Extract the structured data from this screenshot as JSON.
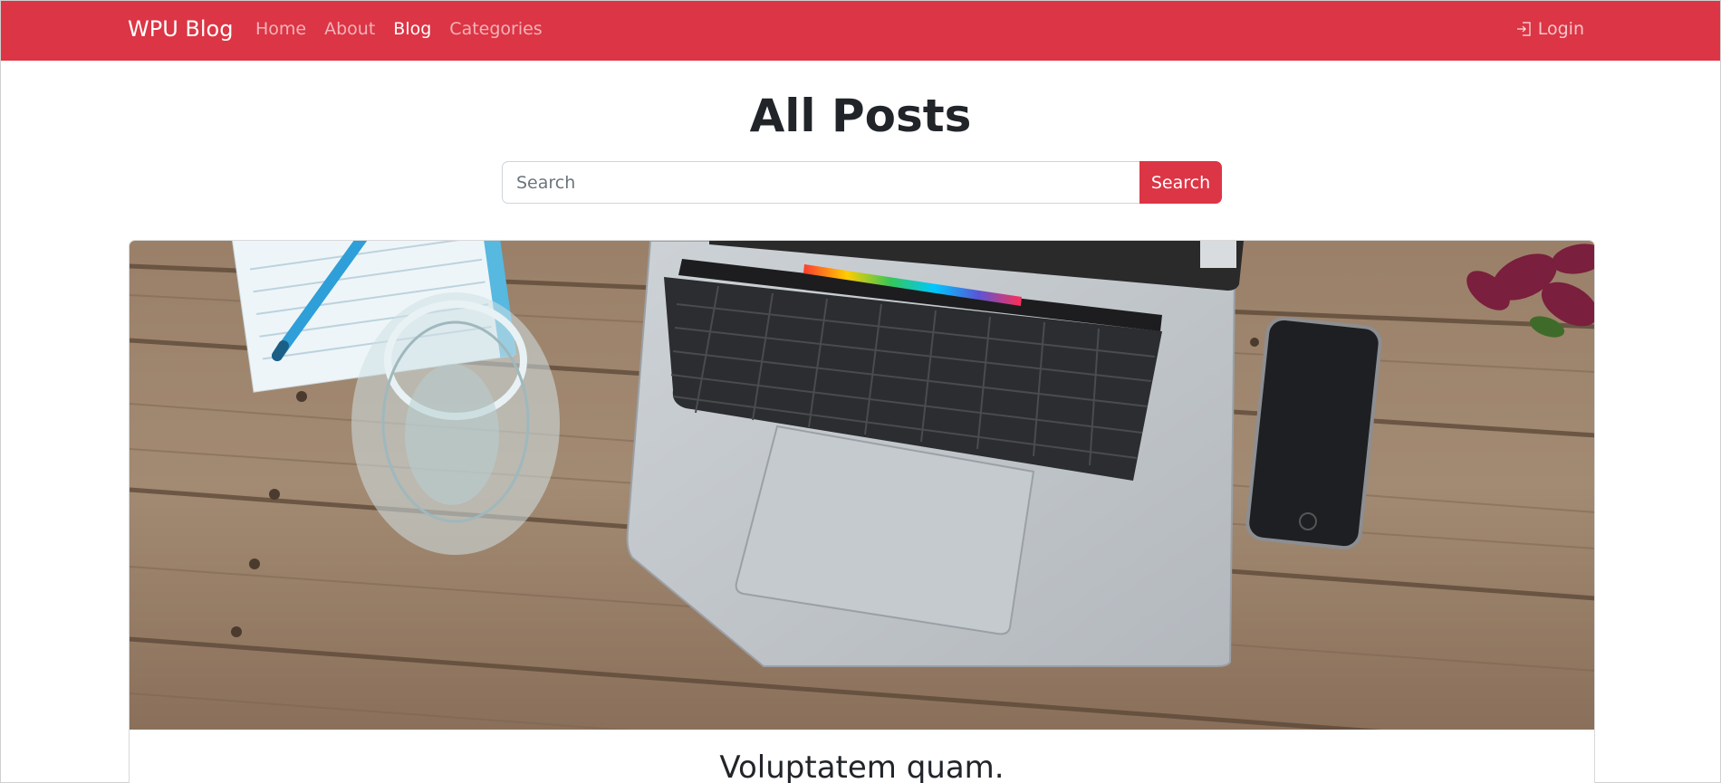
{
  "navbar": {
    "brand": "WPU Blog",
    "links": [
      "Home",
      "About",
      "Blog",
      "Categories"
    ],
    "active": "Blog",
    "login_label": "Login",
    "color": "#dc3545"
  },
  "page": {
    "title": "All Posts"
  },
  "search": {
    "placeholder": "Search",
    "value": "",
    "button_label": "Search"
  },
  "hero_post": {
    "image": "laptop-desk-photo",
    "title": "Voluptatem quam."
  }
}
